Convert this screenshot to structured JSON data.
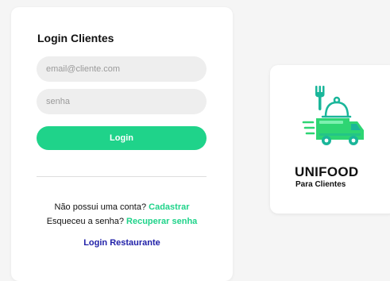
{
  "login": {
    "title": "Login Clientes",
    "email_placeholder": "email@cliente.com",
    "password_placeholder": "senha",
    "button_label": "Login",
    "register_prompt": "Não possui uma conta?",
    "register_link": "Cadastrar",
    "recover_prompt": "Esqueceu a senha?",
    "recover_link": "Recuperar senha",
    "restaurant_link": "Login Restaurante"
  },
  "brand": {
    "name": "UNIFOOD",
    "subtitle": "Para Clientes",
    "logo_icon": "food-delivery-truck-icon"
  },
  "colors": {
    "accent": "#1fd38a",
    "link_blue": "#1f1fa8",
    "logo_teal": "#1ab69a",
    "logo_green": "#2ed573"
  }
}
